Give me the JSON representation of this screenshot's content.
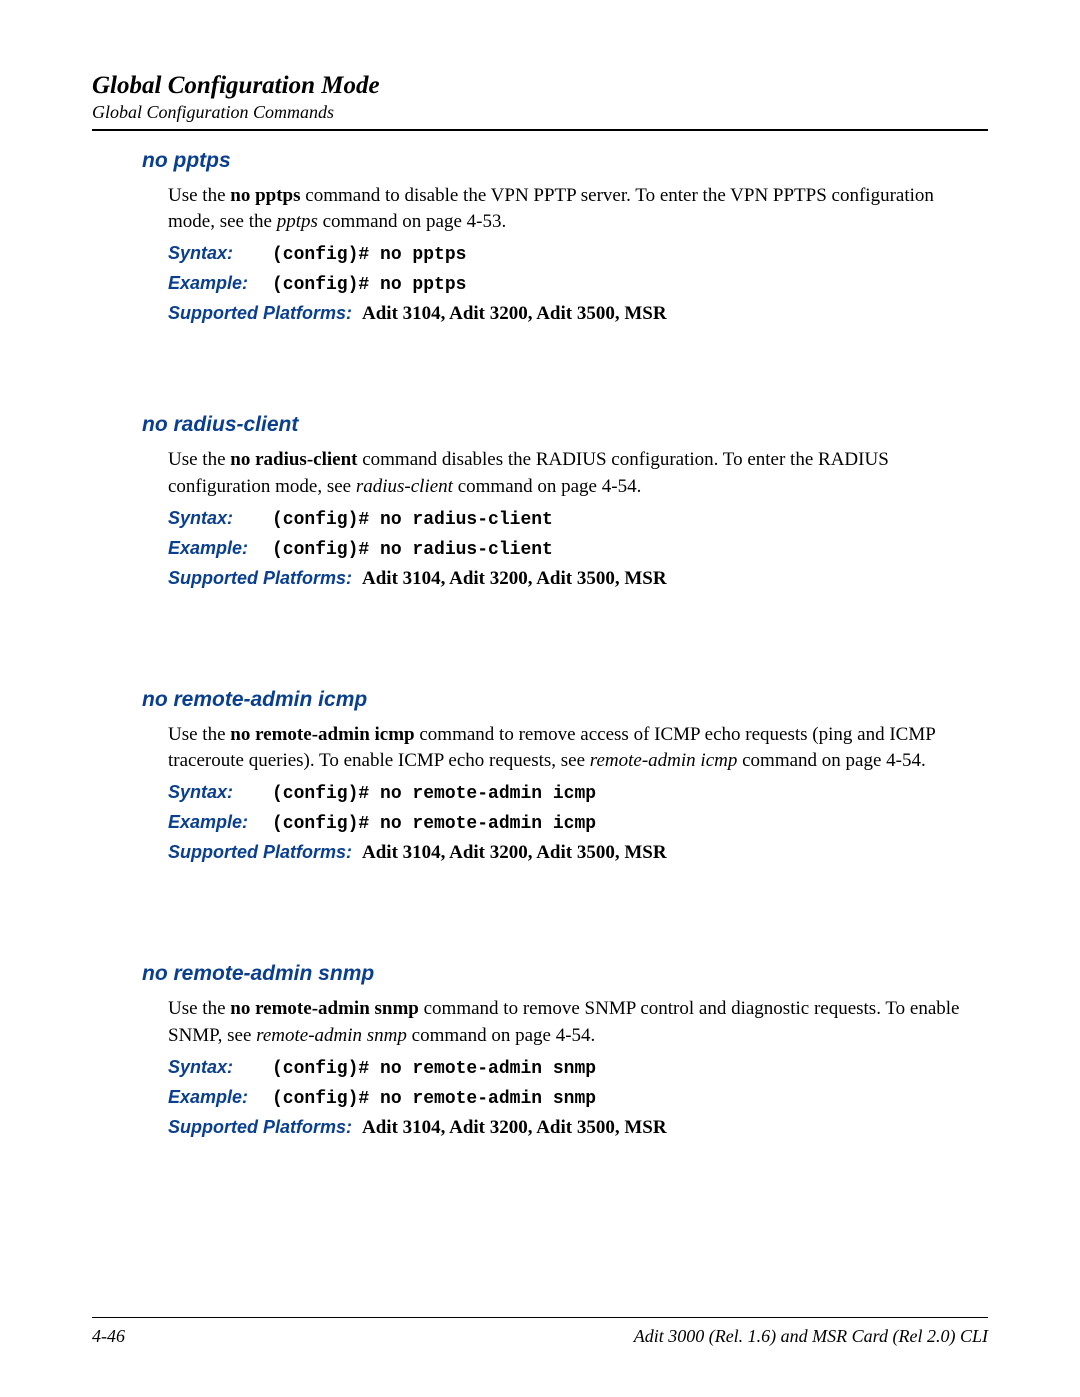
{
  "header": {
    "title": "Global Configuration Mode",
    "subtitle": "Global Configuration Commands"
  },
  "labels": {
    "syntax": "Syntax:",
    "example": "Example:",
    "platforms": "Supported Platforms:"
  },
  "platforms_value": "Adit 3104, Adit 3200, Adit 3500, MSR",
  "sections": {
    "no_pptps": {
      "heading": "no pptps",
      "para_prefix": "Use the ",
      "para_bold": "no pptps",
      "para_mid": " command to disable the VPN PPTP server. To enter the VPN PPTPS configuration mode, see the ",
      "para_italic": "pptps",
      "para_suffix": " command on page 4-53.",
      "syntax": "(config)# no pptps",
      "example": "(config)# no pptps"
    },
    "no_radius_client": {
      "heading": "no radius-client",
      "para_prefix": "Use the ",
      "para_bold": "no radius-client",
      "para_mid": " command disables the RADIUS configuration. To enter the RADIUS configuration mode, see ",
      "para_italic": "radius-client",
      "para_suffix": " command on page 4-54.",
      "syntax": "(config)# no radius-client",
      "example": "(config)# no radius-client"
    },
    "no_remote_admin_icmp": {
      "heading": "no remote-admin icmp",
      "para_prefix": "Use the ",
      "para_bold": "no remote-admin icmp",
      "para_mid": " command to remove access of ICMP echo requests (ping and ICMP traceroute queries). To enable ICMP echo requests, see ",
      "para_italic": "remote-admin icmp",
      "para_suffix": " command on page 4-54.",
      "syntax": "(config)# no remote-admin icmp",
      "example": "(config)# no remote-admin icmp"
    },
    "no_remote_admin_snmp": {
      "heading": "no remote-admin snmp",
      "para_prefix": "Use the ",
      "para_bold": "no remote-admin snmp",
      "para_mid": " command to remove SNMP control and diagnostic requests. To enable SNMP, see ",
      "para_italic": "remote-admin snmp",
      "para_suffix": " command on page 4-54.",
      "syntax": "(config)# no remote-admin snmp",
      "example": "(config)# no remote-admin snmp"
    }
  },
  "footer": {
    "page_number": "4-46",
    "doc_title": "Adit 3000 (Rel. 1.6) and MSR Card (Rel 2.0) CLI"
  }
}
